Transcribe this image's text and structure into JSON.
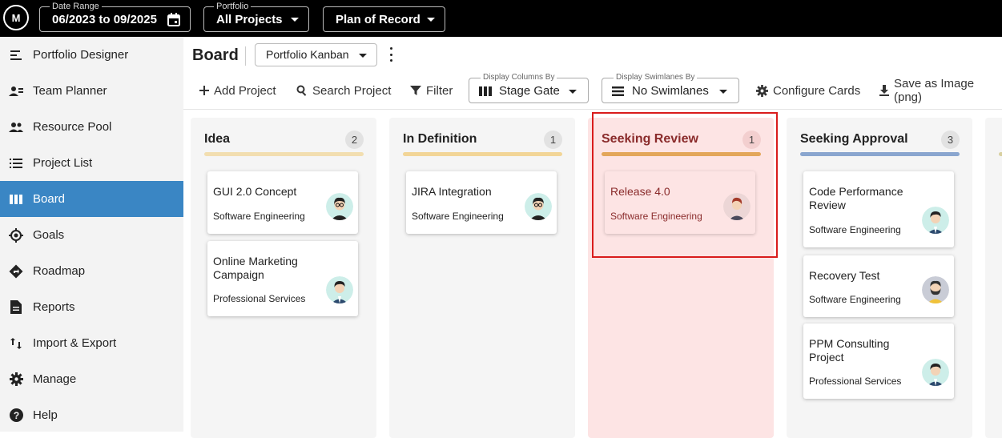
{
  "topbar": {
    "logo": "M",
    "date_range": {
      "label": "Date Range",
      "value": "06/2023 to 09/2025"
    },
    "portfolio": {
      "label": "Portfolio",
      "value": "All Projects"
    },
    "plan": {
      "value": "Plan of Record"
    }
  },
  "sidebar": {
    "items": [
      {
        "label": "Portfolio Designer",
        "icon": "portfolio-designer-icon"
      },
      {
        "label": "Team Planner",
        "icon": "team-planner-icon"
      },
      {
        "label": "Resource Pool",
        "icon": "resource-pool-icon"
      },
      {
        "label": "Project List",
        "icon": "list-icon"
      },
      {
        "label": "Board",
        "icon": "board-icon",
        "active": true
      },
      {
        "label": "Goals",
        "icon": "goals-icon"
      },
      {
        "label": "Roadmap",
        "icon": "roadmap-icon"
      },
      {
        "label": "Reports",
        "icon": "reports-icon"
      },
      {
        "label": "Import & Export",
        "icon": "import-export-icon"
      },
      {
        "label": "Manage",
        "icon": "gear-icon"
      },
      {
        "label": "Help",
        "icon": "help-icon"
      }
    ]
  },
  "header": {
    "title": "Board",
    "board_select": "Portfolio Kanban"
  },
  "toolbar": {
    "add_project": "Add Project",
    "search_project": "Search Project",
    "filter": "Filter",
    "columns": {
      "label": "Display Columns By",
      "value": "Stage Gate"
    },
    "swimlanes": {
      "label": "Display Swimlanes By",
      "value": "No Swimlanes"
    },
    "configure_cards": "Configure Cards",
    "save_image": "Save as Image (png)"
  },
  "columns": [
    {
      "title": "Idea",
      "count": "2",
      "bar_color": "#f2deb0",
      "cards": [
        {
          "title": "GUI 2.0 Concept",
          "sub": "Software Engineering",
          "avatar": "woman-glasses"
        },
        {
          "title": "Online Marketing Campaign",
          "sub": "Professional Services",
          "avatar": "man-dark"
        }
      ]
    },
    {
      "title": "In Definition",
      "count": "1",
      "bar_color": "#f2d597",
      "cards": [
        {
          "title": "JIRA Integration",
          "sub": "Software Engineering",
          "avatar": "woman-glasses"
        }
      ]
    },
    {
      "title": "Seeking Review",
      "count": "1",
      "bar_color": "#e3a65a",
      "highlighted": true,
      "cards": [
        {
          "title": "Release 4.0",
          "sub": "Software Engineering",
          "avatar": "woman-red"
        }
      ]
    },
    {
      "title": "Seeking Approval",
      "count": "3",
      "bar_color": "#8aa6cf",
      "cards": [
        {
          "title": "Code Performance Review",
          "sub": "Software Engineering",
          "avatar": "man-dark"
        },
        {
          "title": "Recovery Test",
          "sub": "Software Engineering",
          "avatar": "man-beard"
        },
        {
          "title": "PPM Consulting Project",
          "sub": "Professional Services",
          "avatar": "man-dark"
        }
      ]
    }
  ]
}
